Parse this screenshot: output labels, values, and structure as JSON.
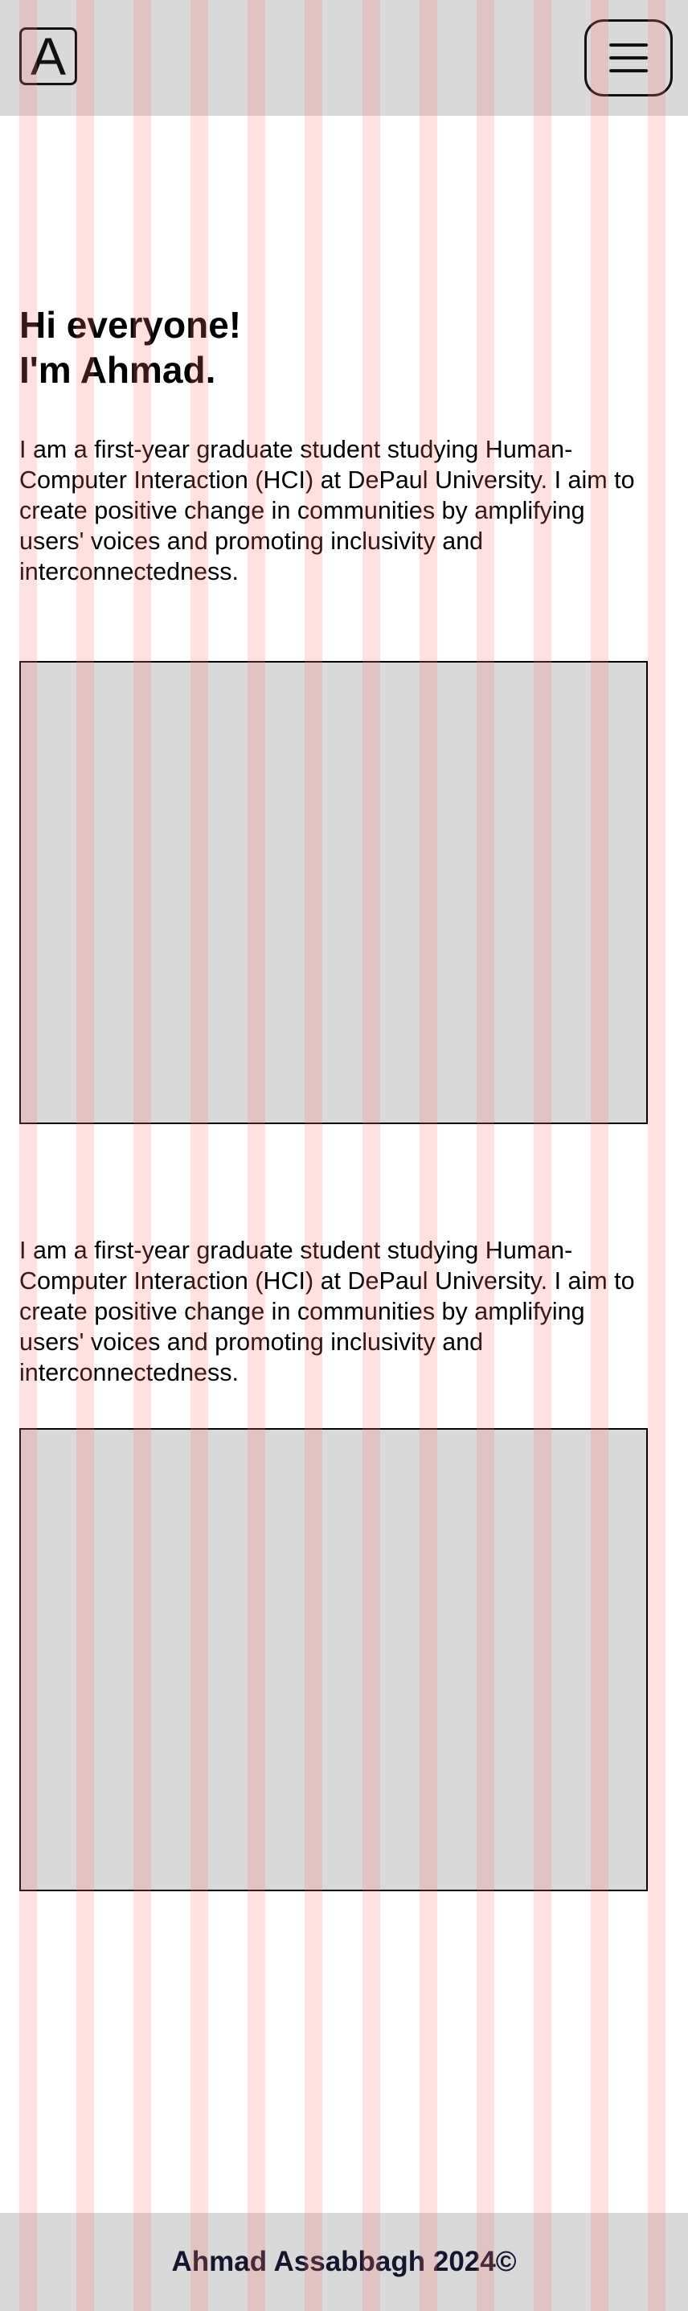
{
  "header": {
    "logo_letter": "A",
    "menu_icon": "hamburger-menu-icon"
  },
  "hero": {
    "greeting_line1": "Hi everyone!",
    "greeting_line2": "I'm Ahmad.",
    "intro": "I am a first-year graduate student studying Human-Computer Interaction (HCI) at DePaul University. I aim to create positive change in communities by amplifying users' voices and promoting inclusivity and interconnectedness."
  },
  "section2": {
    "text": "I am a first-year graduate student studying Human-Computer Interaction (HCI) at DePaul University. I aim to create positive change in communities by amplifying users' voices and promoting inclusivity and interconnectedness."
  },
  "footer": {
    "text": "Ahmad Assabbagh 2024©"
  },
  "colors": {
    "header_bg": "#d9d9d9",
    "placeholder_bg": "#d9d9d9",
    "grid_overlay": "#ff7878",
    "footer_text": "#15152e"
  }
}
